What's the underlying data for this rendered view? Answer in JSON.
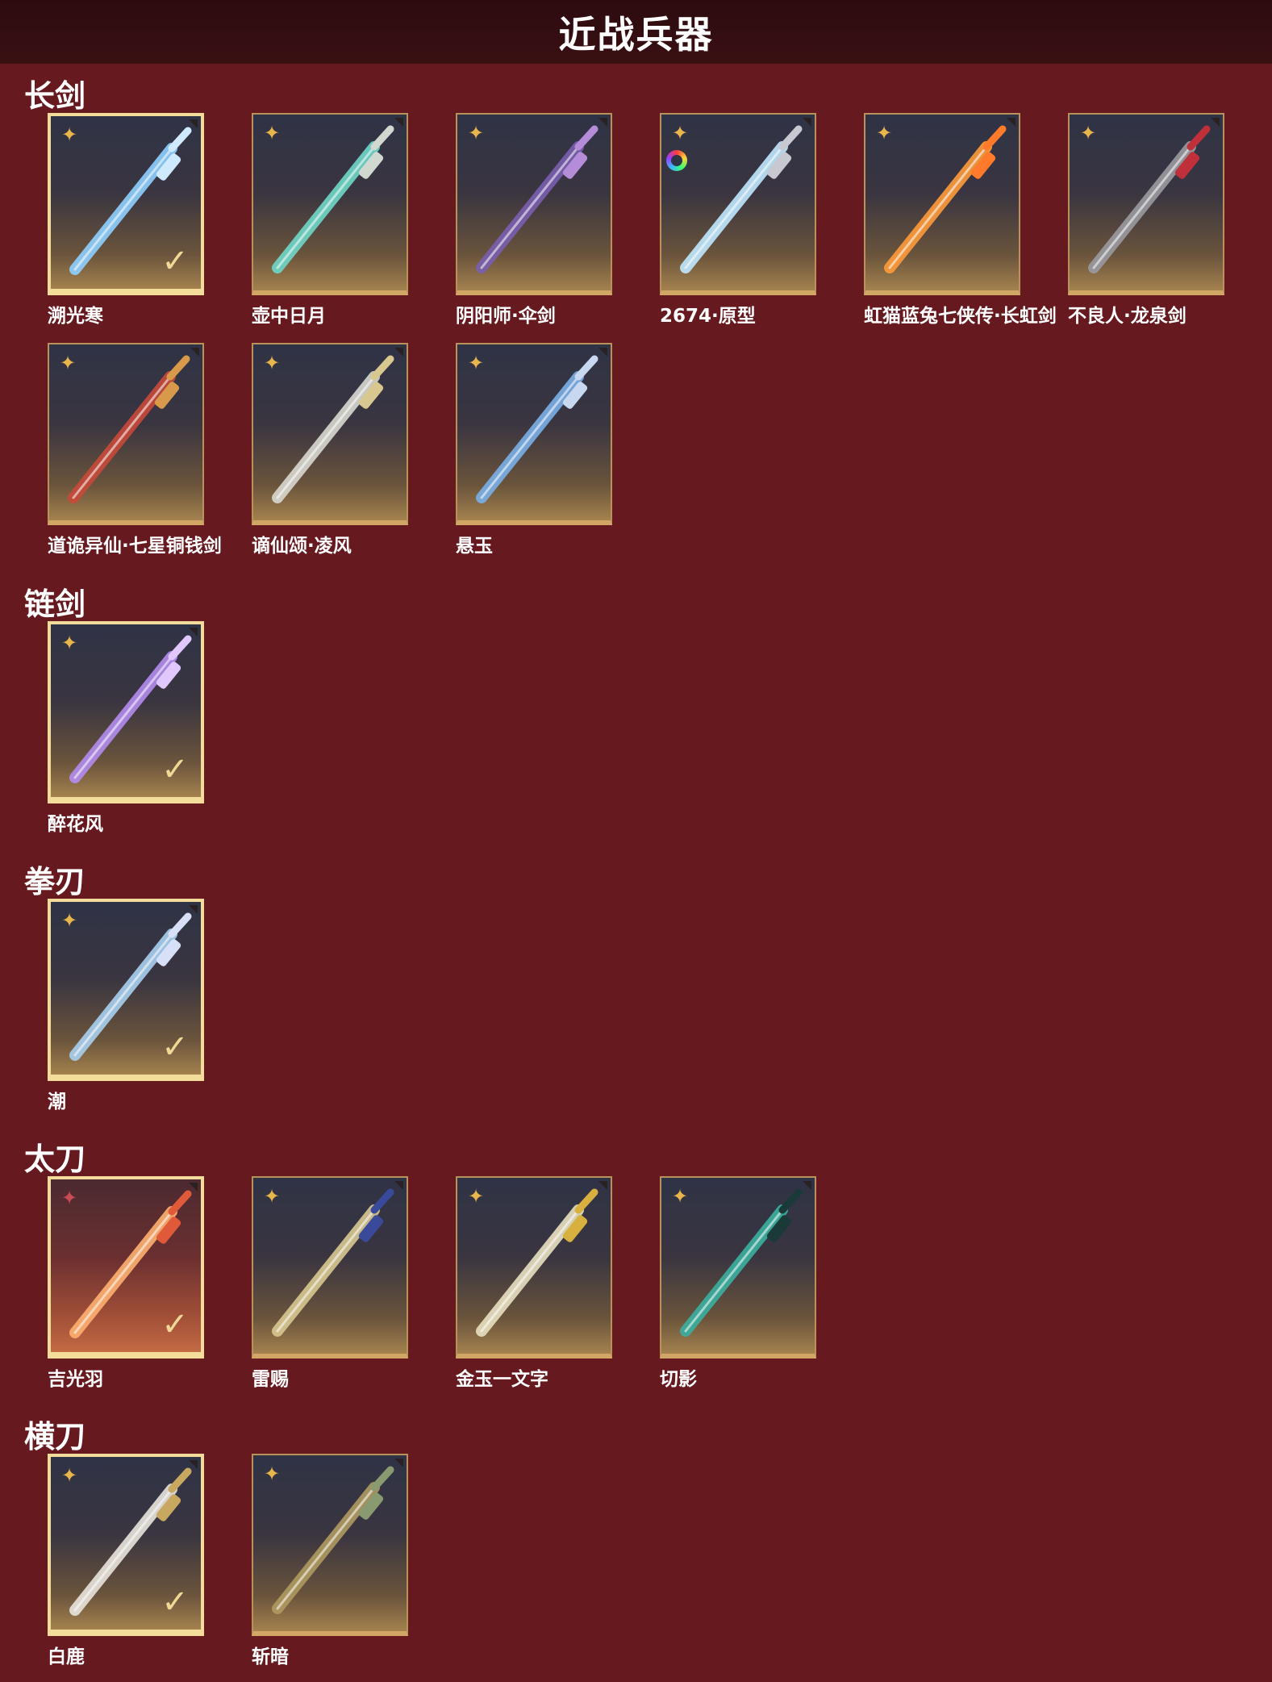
{
  "header": {
    "title": "近战兵器"
  },
  "categories": [
    {
      "title": "长剑",
      "items": [
        {
          "name": "溯光寒",
          "selected": true,
          "badge": "star-icon",
          "blade_color": "#8fd0ff",
          "hilt_color": "#cfe9ff"
        },
        {
          "name": "壶中日月",
          "selected": false,
          "badge": "star-icon",
          "blade_color": "#6fd8c8",
          "hilt_color": "#d0d8d0"
        },
        {
          "name": "阴阳师·伞剑",
          "selected": false,
          "badge": "star-icon",
          "blade_color": "#7a5fb0",
          "hilt_color": "#b48cd8"
        },
        {
          "name": "2674·原型",
          "selected": false,
          "badge": "star-icon",
          "color_wheel": true,
          "blade_color": "#bfe8ff",
          "hilt_color": "#c8c8d0"
        },
        {
          "name": "虹猫蓝兔七侠传·长虹剑",
          "selected": false,
          "badge": "star-icon",
          "blade_color": "#ff9b3a",
          "hilt_color": "#ff7a2a"
        },
        {
          "name": "不良人·龙泉剑",
          "selected": false,
          "badge": "star-icon",
          "blade_color": "#9a9aa0",
          "hilt_color": "#c0303a"
        },
        {
          "name": "道诡异仙·七星铜钱剑",
          "selected": false,
          "badge": "star-icon",
          "blade_color": "#c84a3a",
          "hilt_color": "#d89a4a"
        },
        {
          "name": "谪仙颂·凌风",
          "selected": false,
          "badge": "star-icon",
          "blade_color": "#d8d8d0",
          "hilt_color": "#d8c890"
        },
        {
          "name": "悬玉",
          "selected": false,
          "badge": "star-icon",
          "blade_color": "#7ab0e8",
          "hilt_color": "#c8d8f0"
        }
      ]
    },
    {
      "title": "链剑",
      "items": [
        {
          "name": "醉花风",
          "selected": true,
          "badge": "star-icon",
          "blade_color": "#b48cf0",
          "hilt_color": "#e0c8ff"
        }
      ]
    },
    {
      "title": "拳刃",
      "items": [
        {
          "name": "潮",
          "selected": true,
          "badge": "star-icon",
          "blade_color": "#a8d0f0",
          "hilt_color": "#d8e0f8"
        }
      ]
    },
    {
      "title": "太刀",
      "items": [
        {
          "name": "吉光羽",
          "selected": true,
          "badge": "red-star-icon",
          "red_frame": true,
          "blade_color": "#ffb070",
          "hilt_color": "#e05a3a"
        },
        {
          "name": "雷赐",
          "selected": false,
          "badge": "star-icon",
          "blade_color": "#d8c890",
          "hilt_color": "#3a4a9a"
        },
        {
          "name": "金玉一文字",
          "selected": false,
          "badge": "star-icon",
          "blade_color": "#e8e0c0",
          "hilt_color": "#d8b040"
        },
        {
          "name": "切影",
          "selected": false,
          "badge": "star-icon",
          "blade_color": "#3ab0a0",
          "hilt_color": "#1a3a38"
        }
      ]
    },
    {
      "title": "横刀",
      "items": [
        {
          "name": "白鹿",
          "selected": true,
          "badge": "star-icon",
          "blade_color": "#e8e4dc",
          "hilt_color": "#c8a860"
        },
        {
          "name": "斩暗",
          "selected": false,
          "badge": "star-icon",
          "blade_color": "#b09a60",
          "hilt_color": "#8a9a70"
        }
      ]
    }
  ]
}
